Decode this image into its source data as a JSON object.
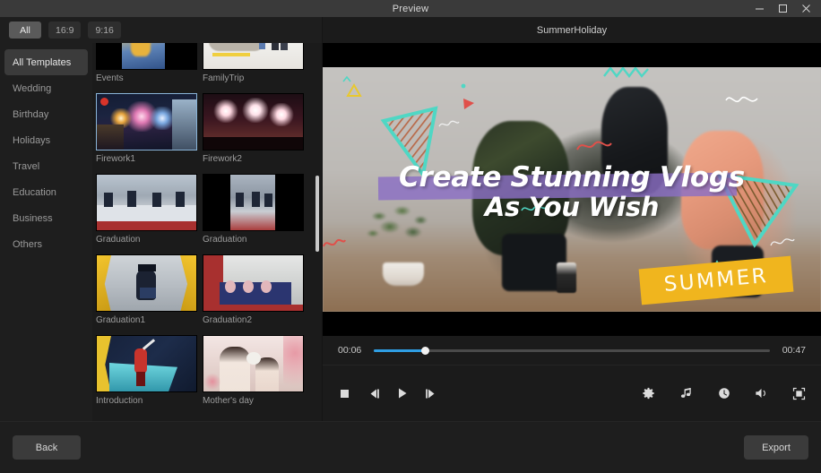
{
  "window": {
    "title": "Preview",
    "minimize_icon": "minimize-icon",
    "maximize_icon": "maximize-icon",
    "close_icon": "close-icon"
  },
  "ratio_tabs": [
    {
      "label": "All",
      "active": true
    },
    {
      "label": "16:9",
      "active": false
    },
    {
      "label": "9:16",
      "active": false
    }
  ],
  "categories": [
    {
      "label": "All Templates",
      "active": true
    },
    {
      "label": "Wedding",
      "active": false
    },
    {
      "label": "Birthday",
      "active": false
    },
    {
      "label": "Holidays",
      "active": false
    },
    {
      "label": "Travel",
      "active": false
    },
    {
      "label": "Education",
      "active": false
    },
    {
      "label": "Business",
      "active": false
    },
    {
      "label": "Others",
      "active": false
    }
  ],
  "templates": [
    {
      "label": "Events",
      "selected": false,
      "style": "events"
    },
    {
      "label": "FamilyTrip",
      "selected": false,
      "style": "familytrip"
    },
    {
      "label": "Firework1",
      "selected": true,
      "style": "firework1"
    },
    {
      "label": "Firework2",
      "selected": false,
      "style": "firework2"
    },
    {
      "label": "Graduation",
      "selected": false,
      "style": "graduation"
    },
    {
      "label": "Graduation",
      "selected": false,
      "style": "graduation-dark"
    },
    {
      "label": "Graduation1",
      "selected": false,
      "style": "graduation1"
    },
    {
      "label": "Graduation2",
      "selected": false,
      "style": "graduation2"
    },
    {
      "label": "Introduction",
      "selected": false,
      "style": "introduction"
    },
    {
      "label": "Mother's day",
      "selected": false,
      "style": "mothersday"
    }
  ],
  "preview": {
    "project_title": "SummerHoliday",
    "overlay_line1": "Create Stunning Vlogs",
    "overlay_line2": "As You Wish",
    "overlay_badge": "SUMMER",
    "band_color": "#8b6fc4",
    "badge_color": "#f0b51e",
    "accent_teal": "#4fd7c4"
  },
  "player": {
    "current_time": "00:06",
    "total_time": "00:47",
    "progress_percent": 13,
    "progress_color": "#2f9ee3",
    "left_controls": [
      {
        "name": "stop-button",
        "icon": "stop-icon"
      },
      {
        "name": "previous-frame-button",
        "icon": "previous-frame-icon"
      },
      {
        "name": "play-button",
        "icon": "play-icon"
      },
      {
        "name": "next-frame-button",
        "icon": "next-frame-icon"
      }
    ],
    "right_controls": [
      {
        "name": "settings-button",
        "icon": "gear-icon"
      },
      {
        "name": "music-button",
        "icon": "music-note-icon"
      },
      {
        "name": "duration-button",
        "icon": "clock-icon"
      },
      {
        "name": "volume-button",
        "icon": "volume-icon"
      },
      {
        "name": "fullscreen-button",
        "icon": "fullscreen-icon"
      }
    ]
  },
  "footer": {
    "back_label": "Back",
    "export_label": "Export"
  }
}
